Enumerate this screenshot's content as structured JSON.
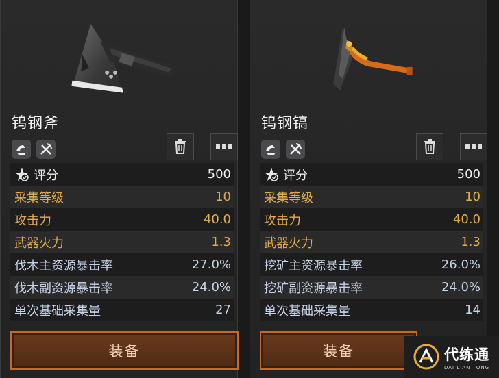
{
  "cards": [
    {
      "name": "钨钢斧",
      "tags": [
        "harvest-icon",
        "pickaxe-axe-icon"
      ],
      "stats": [
        {
          "label": "评分",
          "value": "500",
          "icon": "score-star-icon"
        },
        {
          "label": "采集等级",
          "value": "10"
        },
        {
          "label": "攻击力",
          "value": "40.0"
        },
        {
          "label": "武器火力",
          "value": "1.3"
        },
        {
          "label": "伐木主资源暴击率",
          "value": "27.0%"
        },
        {
          "label": "伐木副资源暴击率",
          "value": "24.0%"
        },
        {
          "label": "单次基础采集量",
          "value": "27"
        }
      ],
      "equip_label": "装备"
    },
    {
      "name": "钨钢镐",
      "tags": [
        "harvest-icon",
        "pickaxe-axe-icon"
      ],
      "stats": [
        {
          "label": "评分",
          "value": "500",
          "icon": "score-star-icon"
        },
        {
          "label": "采集等级",
          "value": "10"
        },
        {
          "label": "攻击力",
          "value": "40.0"
        },
        {
          "label": "武器火力",
          "value": "1.3"
        },
        {
          "label": "挖矿主资源暴击率",
          "value": "26.0%"
        },
        {
          "label": "挖矿副资源暴击率",
          "value": "24.0%"
        },
        {
          "label": "单次基础采集量",
          "value": "14"
        }
      ],
      "equip_label": "装备"
    }
  ],
  "watermark": {
    "cn": "代练通",
    "en": "DAI LIAN TONG"
  },
  "colors": {
    "gold": "#e2ac4e",
    "blue": "#c6d2e6",
    "equip_border": "#c26b2b"
  }
}
